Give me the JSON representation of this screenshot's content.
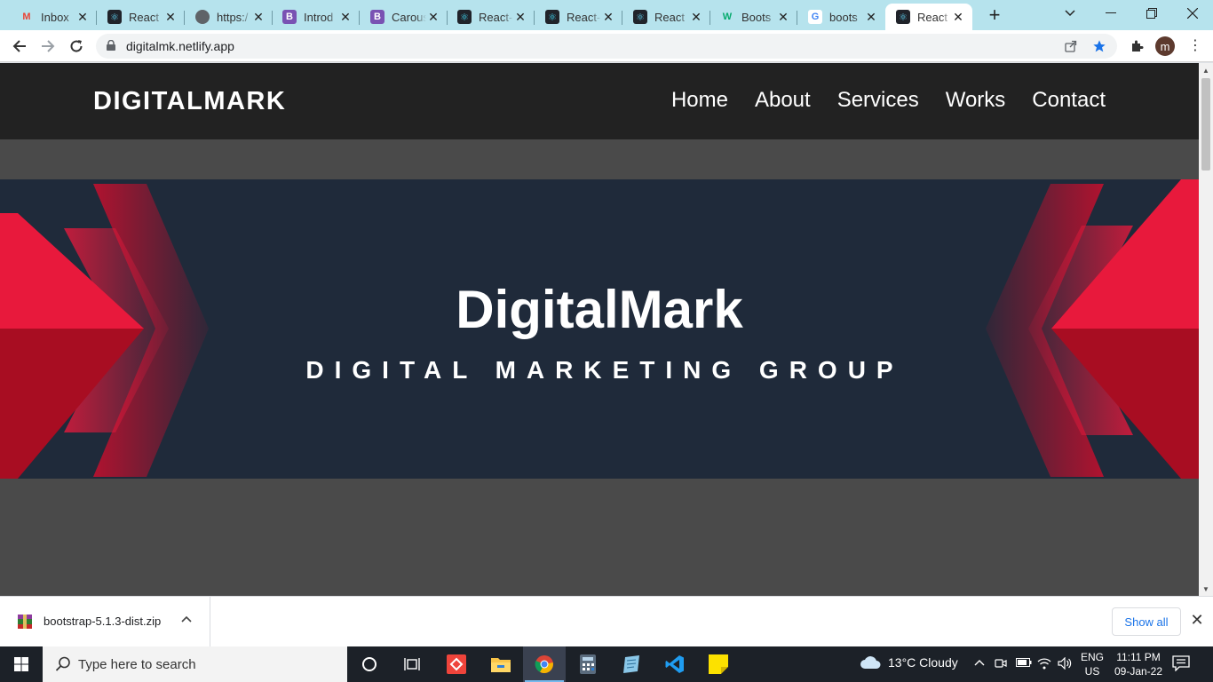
{
  "browser": {
    "tabs": [
      {
        "title": "Inbox",
        "icon": "gmail-icon",
        "color": "#ea4335"
      },
      {
        "title": "React",
        "icon": "react-icon",
        "color": "#61dafb"
      },
      {
        "title": "https:/",
        "icon": "globe-icon",
        "color": "#5f6368"
      },
      {
        "title": "Introd",
        "icon": "bootstrap-icon",
        "color": "#7952b3"
      },
      {
        "title": "Carous",
        "icon": "bootstrap-icon",
        "color": "#7952b3"
      },
      {
        "title": "React-",
        "icon": "react-bootstrap-icon",
        "color": "#41e0fd"
      },
      {
        "title": "React-",
        "icon": "react-bootstrap-icon",
        "color": "#41e0fd"
      },
      {
        "title": "React",
        "icon": "react-icon",
        "color": "#61dafb"
      },
      {
        "title": "Boots",
        "icon": "w3schools-icon",
        "color": "#04aa6d"
      },
      {
        "title": "boots",
        "icon": "google-icon",
        "color": "#4285f4"
      },
      {
        "title": "React",
        "icon": "react-icon",
        "color": "#61dafb",
        "active": true
      }
    ],
    "url": "digitalmk.netlify.app",
    "profile_initial": "m"
  },
  "site": {
    "brand": "DIGITALMARK",
    "nav": [
      "Home",
      "About",
      "Services",
      "Works",
      "Contact"
    ],
    "hero_title": "DigitalMark",
    "hero_subtitle": "DIGITAL MARKETING GROUP"
  },
  "downloads": {
    "file": "bootstrap-5.1.3-dist.zip",
    "show_all": "Show all"
  },
  "taskbar": {
    "search_placeholder": "Type here to search",
    "weather": "13°C  Cloudy",
    "lang_top": "ENG",
    "lang_bottom": "US",
    "time": "11:11 PM",
    "date": "09-Jan-22"
  },
  "colors": {
    "accent_red": "#e8193c",
    "hero_bg": "#1f2a3a",
    "nav_bg": "#222222"
  }
}
